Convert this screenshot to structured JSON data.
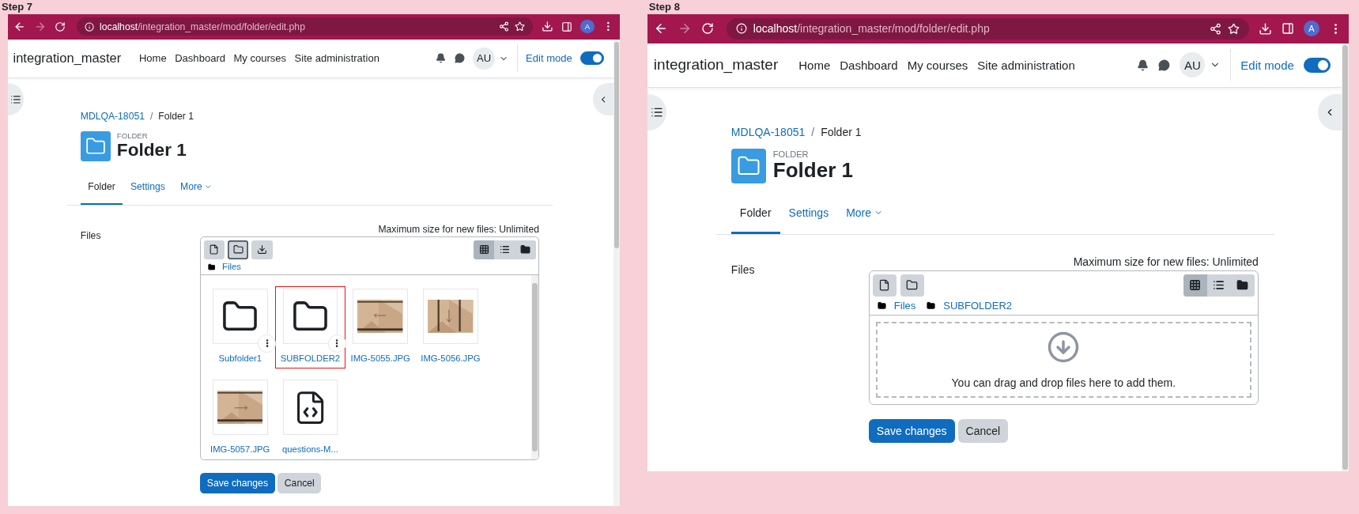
{
  "panels": [
    {
      "step_label": "Step 7",
      "browser": {
        "url_host": "localhost",
        "url_path": "/integration_master/mod/folder/edit.php",
        "forward_enabled": false,
        "profile_initial": "A"
      },
      "navbar": {
        "site_name": "integration_master",
        "links": [
          "Home",
          "Dashboard",
          "My courses",
          "Site administration"
        ],
        "user_initials": "AU",
        "edit_mode_label": "Edit mode",
        "edit_mode_on": true
      },
      "breadcrumb": [
        {
          "label": "MDLQA-18051",
          "link": true
        },
        {
          "label": "Folder 1",
          "link": false
        }
      ],
      "breadcrumb_separator": "/",
      "header": {
        "type_label": "FOLDER",
        "title": "Folder 1"
      },
      "tabs": [
        {
          "label": "Folder",
          "selected": true
        },
        {
          "label": "Settings",
          "selected": false
        },
        {
          "label": "More",
          "selected": false
        }
      ],
      "form": {
        "label": "Files",
        "max_size": "Maximum size for new files: Unlimited"
      },
      "filepicker": {
        "toolbar": [
          {
            "kind": "add-file",
            "focused": false
          },
          {
            "kind": "create-folder",
            "focused": true
          },
          {
            "kind": "download",
            "focused": false
          }
        ],
        "views": [
          {
            "kind": "grid",
            "selected": true
          },
          {
            "kind": "list",
            "selected": false
          },
          {
            "kind": "tree",
            "selected": false
          }
        ],
        "path": [
          "Files"
        ],
        "content": {
          "kind": "grid",
          "items": [
            {
              "name": "Subfolder1",
              "kind": "folder",
              "highlighted": false
            },
            {
              "name": "SUBFOLDER2",
              "kind": "folder",
              "highlighted": true
            },
            {
              "name": "IMG-5055.JPG",
              "kind": "picture",
              "highlighted": false
            },
            {
              "name": "IMG-5056.JPG",
              "kind": "picture",
              "highlighted": false
            },
            {
              "name": "IMG-5057.JPG",
              "kind": "picture",
              "highlighted": false
            },
            {
              "name": "questions-M...",
              "kind": "code",
              "highlighted": false
            }
          ]
        }
      },
      "buttons": [
        {
          "label": "Save changes",
          "primary": true
        },
        {
          "label": "Cancel",
          "primary": false
        }
      ]
    },
    {
      "step_label": "Step 8",
      "browser": {
        "url_host": "localhost",
        "url_path": "/integration_master/mod/folder/edit.php",
        "forward_enabled": false,
        "profile_initial": "A"
      },
      "navbar": {
        "site_name": "integration_master",
        "links": [
          "Home",
          "Dashboard",
          "My courses",
          "Site administration"
        ],
        "user_initials": "AU",
        "edit_mode_label": "Edit mode",
        "edit_mode_on": true
      },
      "breadcrumb": [
        {
          "label": "MDLQA-18051",
          "link": true
        },
        {
          "label": "Folder 1",
          "link": false
        }
      ],
      "breadcrumb_separator": "/",
      "header": {
        "type_label": "FOLDER",
        "title": "Folder 1"
      },
      "tabs": [
        {
          "label": "Folder",
          "selected": true
        },
        {
          "label": "Settings",
          "selected": false
        },
        {
          "label": "More",
          "selected": false
        }
      ],
      "form": {
        "label": "Files",
        "max_size": "Maximum size for new files: Unlimited"
      },
      "filepicker": {
        "toolbar": [
          {
            "kind": "add-file",
            "focused": false
          },
          {
            "kind": "create-folder",
            "focused": false
          }
        ],
        "views": [
          {
            "kind": "grid",
            "selected": true
          },
          {
            "kind": "list",
            "selected": false
          },
          {
            "kind": "tree",
            "selected": false
          }
        ],
        "path": [
          "Files",
          "SUBFOLDER2"
        ],
        "content": {
          "kind": "dropzone",
          "text": "You can drag and drop files here to add them."
        }
      },
      "buttons": [
        {
          "label": "Save changes",
          "primary": true
        },
        {
          "label": "Cancel",
          "primary": false
        }
      ]
    }
  ]
}
